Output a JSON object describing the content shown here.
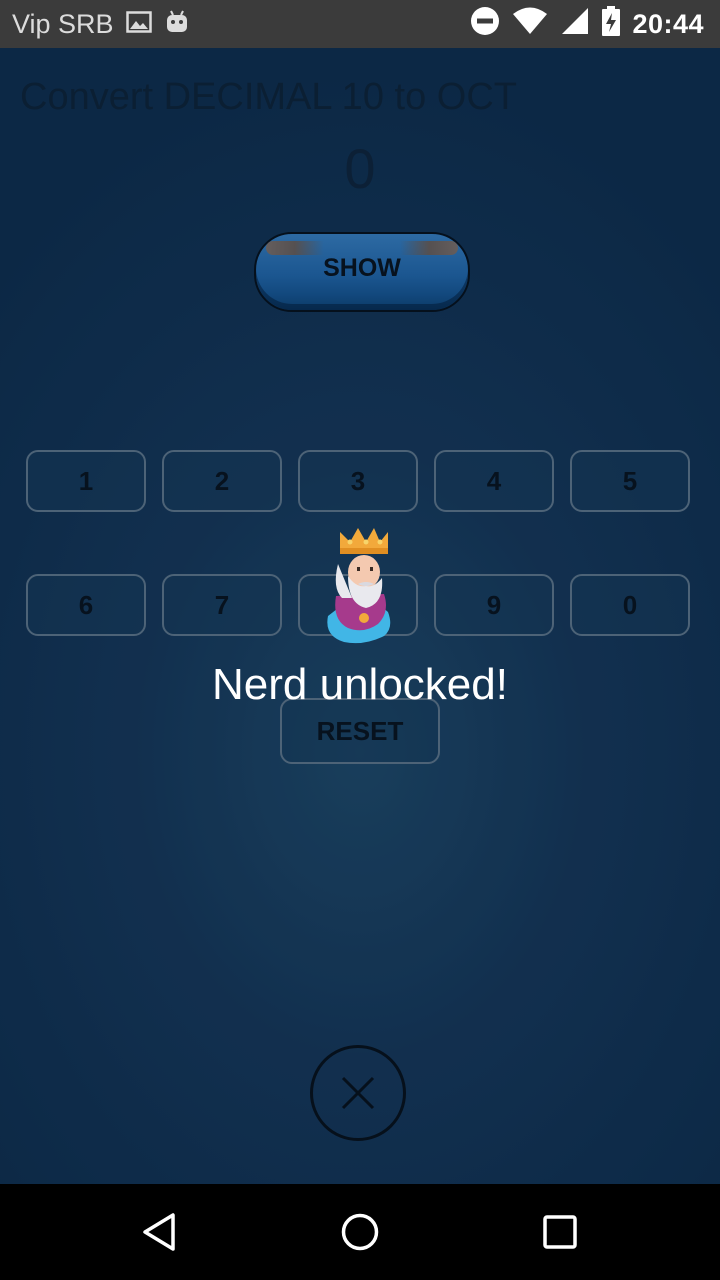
{
  "status_bar": {
    "carrier": "Vip SRB",
    "time": "20:44",
    "icons": [
      "image-icon",
      "android-icon",
      "do-not-disturb-icon",
      "wifi-icon",
      "signal-icon",
      "battery-charging-icon"
    ]
  },
  "converter": {
    "title": "Convert DECIMAL 10 to OCT",
    "result": "0",
    "show_label": "SHOW"
  },
  "keypad": {
    "row1": [
      "1",
      "2",
      "3",
      "4",
      "5"
    ],
    "row2": [
      "6",
      "7",
      "8",
      "9",
      "0"
    ],
    "reset_label": "RESET"
  },
  "achievement": {
    "message": "Nerd unlocked!",
    "avatar": "king-avatar-icon"
  },
  "overlay": {
    "close_icon": "close-icon"
  },
  "navigation": {
    "icons": [
      "back-icon",
      "home-icon",
      "recents-icon"
    ]
  },
  "colors": {
    "background": "#16385a",
    "key_border": "#4d6377",
    "toast_text": "#ffffff"
  }
}
